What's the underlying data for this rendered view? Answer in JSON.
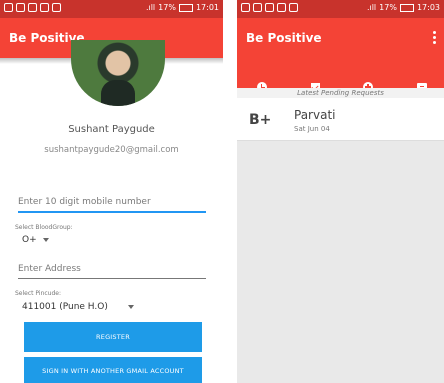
{
  "left": {
    "status_bar": {
      "signal": ".ıll",
      "battery": "17%",
      "time": "17:01"
    },
    "appbar_title": "Be Positive",
    "profile": {
      "name": "Sushant Paygude",
      "email": "sushantpaygude20@gmail.com"
    },
    "mobile_placeholder": "Enter 10 digit mobile number",
    "blood_group": {
      "label": "Select BloodGroup:",
      "value": "O+"
    },
    "address_placeholder": "Enter Address",
    "pincode": {
      "label": "Select Pincude:",
      "value": "411001 (Pune H.O)"
    },
    "register_label": "REGISTER",
    "signin_label": "SIGN IN WITH ANOTHER GMAIL ACCOUNT"
  },
  "right": {
    "status_bar": {
      "signal": ".ıll",
      "battery": "17%",
      "time": "17:03"
    },
    "appbar_title": "Be Positive",
    "tabs": [
      {
        "icon": "clock-icon",
        "active": true
      },
      {
        "icon": "check-icon",
        "active": false
      },
      {
        "icon": "plus-icon",
        "active": false
      },
      {
        "icon": "chat-icon",
        "active": false
      }
    ],
    "section_header": "Latest Pending Requests",
    "requests": [
      {
        "blood_group": "B+",
        "name": "Parvati",
        "date": "Sat Jun 04"
      }
    ]
  },
  "colors": {
    "appbar": "#f44336",
    "statusbar": "#c8332c",
    "button": "#1e9be8",
    "accent": "#2196f3"
  }
}
